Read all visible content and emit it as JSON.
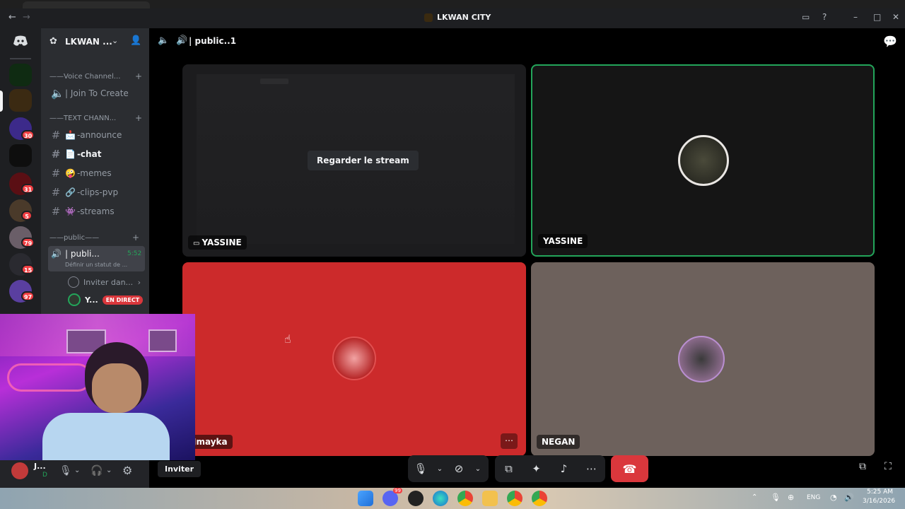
{
  "window": {
    "title": "LKWAN CITY",
    "colors": {
      "accent": "#5865f2",
      "danger": "#da373c",
      "speaking": "#23a55a"
    }
  },
  "servers": {
    "badges": [
      "30",
      "31",
      "5",
      "79",
      "15",
      "97"
    ]
  },
  "sidebar": {
    "server_name": "LKWAN ...",
    "categories": {
      "voice": "——Voice Channel...",
      "text": "——TEXT CHANN...",
      "public": "——public——"
    },
    "join_to_create": "| Join To Create",
    "text_channels": [
      {
        "emoji": "📩",
        "name": "-announce"
      },
      {
        "emoji": "📄",
        "name": "-chat"
      },
      {
        "emoji": "🤪",
        "name": "-memes"
      },
      {
        "emoji": "🔗",
        "name": "-clips-pvp"
      },
      {
        "emoji": "👾",
        "name": "-streams"
      }
    ],
    "active_voice": {
      "name": "| publi...",
      "time": "5:52",
      "status": "Définir un statut de ..."
    },
    "invite_row": "Inviter dan...",
    "live_user": {
      "name": "Y...",
      "badge": "EN DIRECT"
    }
  },
  "userbar": {
    "name": "J...",
    "status": "D"
  },
  "main": {
    "channel_name": "| public..1",
    "invite_button": "Inviter",
    "tiles": [
      {
        "label": "YASSINE",
        "button": "Regarder le stream",
        "kind": "stream"
      },
      {
        "label": "YASSINE",
        "kind": "camera-off",
        "speaking": true
      },
      {
        "label": "Jmayka",
        "kind": "camera-off",
        "bg": "#cc2a2b"
      },
      {
        "label": "NEGAN",
        "kind": "camera-off",
        "bg": "#6d615c"
      }
    ]
  },
  "taskbar": {
    "lang": "ENG",
    "time": "5:25 AM",
    "date": "3/16/2026",
    "discord_badge": "99"
  }
}
